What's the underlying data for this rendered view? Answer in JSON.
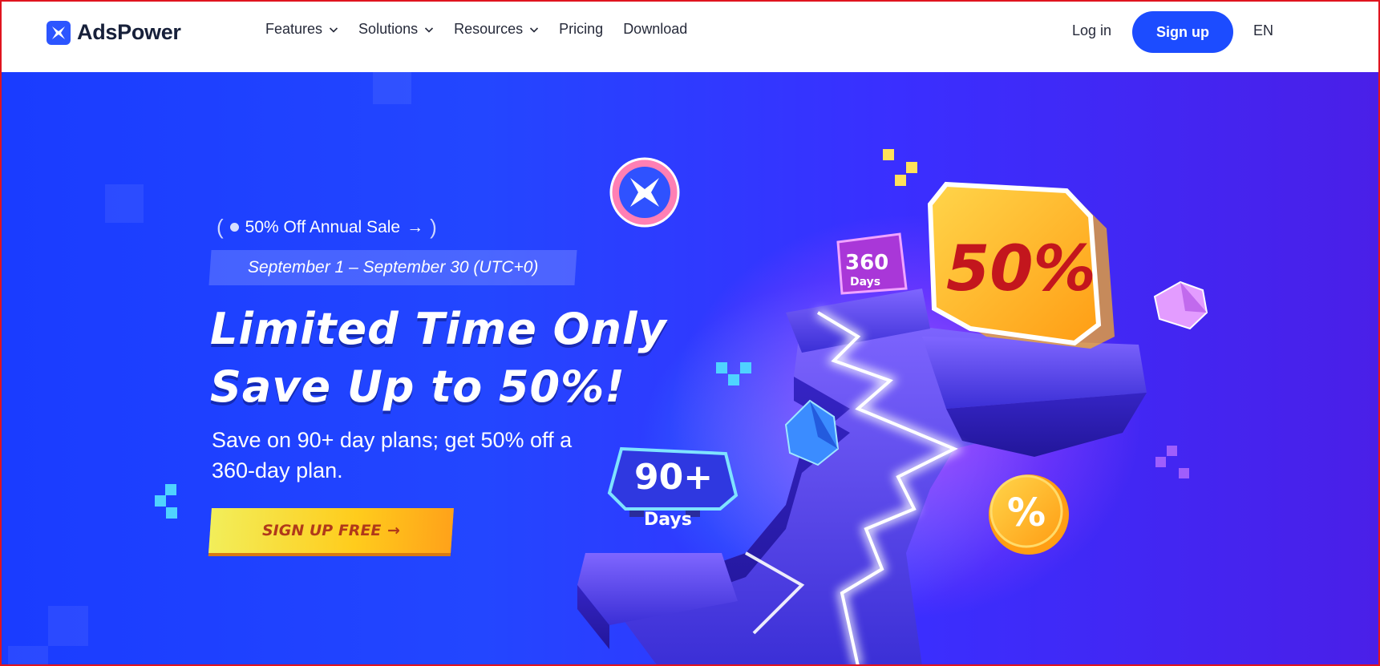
{
  "header": {
    "logo_text": "AdsPower",
    "nav": [
      {
        "label": "Features",
        "has_dropdown": true
      },
      {
        "label": "Solutions",
        "has_dropdown": true
      },
      {
        "label": "Resources",
        "has_dropdown": true
      },
      {
        "label": "Pricing",
        "has_dropdown": false
      },
      {
        "label": "Download",
        "has_dropdown": false
      }
    ],
    "login_label": "Log in",
    "signup_label": "Sign up",
    "language": "EN"
  },
  "hero": {
    "sale_tag": "50% Off Annual Sale",
    "sale_tag_arrow": "→",
    "date_range": "September 1 – September 30 (UTC+0)",
    "headline_line1": "Limited Time Only",
    "headline_line2": "Save Up to 50%!",
    "subtext": "Save on 90+ day plans; get 50% off a 360-day plan.",
    "cta_label": "SIGN UP FREE",
    "cta_arrow": "→",
    "art": {
      "badge_big": "50%",
      "badge_360_num": "360",
      "badge_360_unit": "Days",
      "badge_90_num": "90+",
      "badge_90_unit": "Days",
      "coin_symbol": "%"
    }
  },
  "colors": {
    "brand": "#1c4cff",
    "cta_yellow": "#ffcc1c",
    "cta_text": "#b0391a"
  }
}
